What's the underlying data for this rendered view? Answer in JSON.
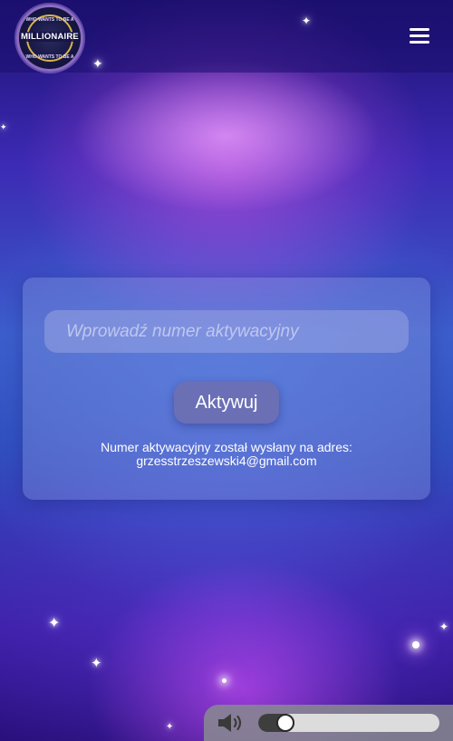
{
  "logo": {
    "top_text": "WHO WANTS TO BE A",
    "title": "MILLIONAIRE",
    "bottom_text": "WHO WANTS TO BE A"
  },
  "menu": {
    "icon": "hamburger-menu-icon"
  },
  "activation": {
    "placeholder": "Wprowadź numer aktywacyjny",
    "value": "",
    "button_label": "Aktywuj",
    "info_line1": "Numer aktywacyjny został wysłany na adres:",
    "info_email": "grzesstrzeszewski4@gmail.com"
  },
  "sound": {
    "icon": "volume-icon",
    "volume_fraction": 0.11
  },
  "colors": {
    "background_top": "#1e1070",
    "background_mid": "#3a5ac8",
    "background_bottom": "#270d78",
    "card": "#969fe1",
    "button": "#6e6eaf",
    "sound_bar": "#878791"
  }
}
